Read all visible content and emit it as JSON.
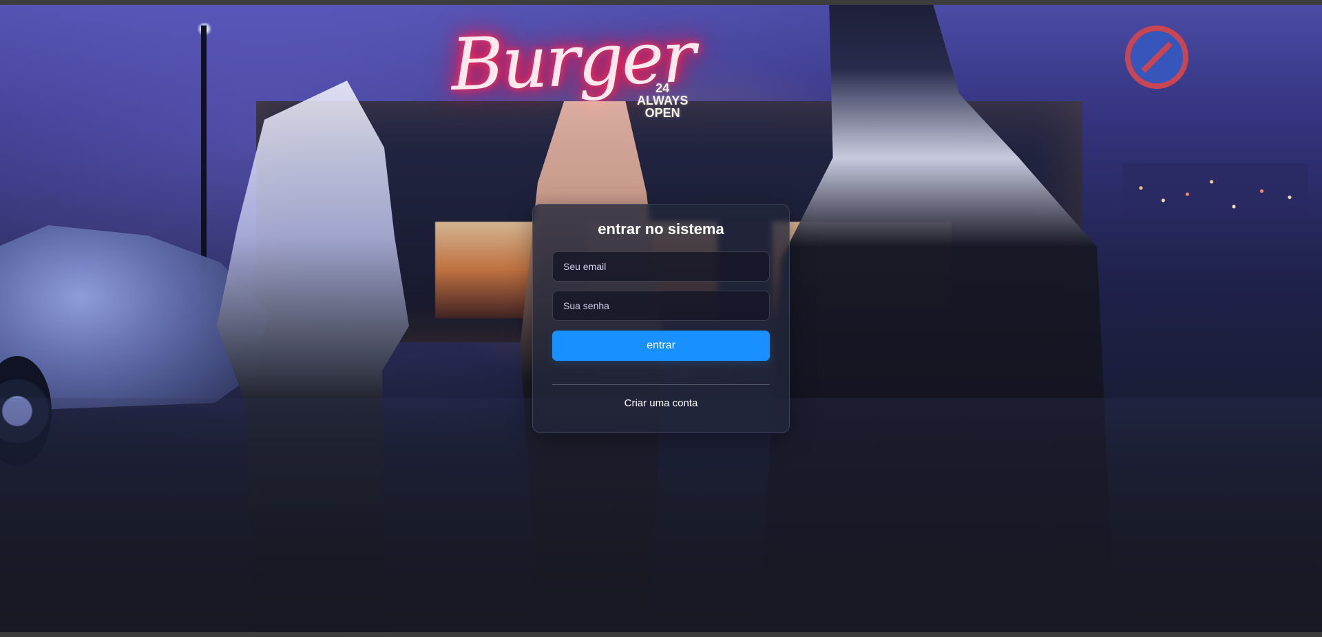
{
  "background": {
    "sign_text": "Burger",
    "sign_subtext": "24\nALWAYS\nOPEN"
  },
  "login": {
    "title": "entrar no sistema",
    "email_placeholder": "Seu email",
    "password_placeholder": "Sua senha",
    "submit_label": "entrar",
    "create_account_label": "Criar uma conta"
  },
  "colors": {
    "accent": "#1890ff",
    "card_background": "#22263a",
    "text": "#ffffff"
  }
}
